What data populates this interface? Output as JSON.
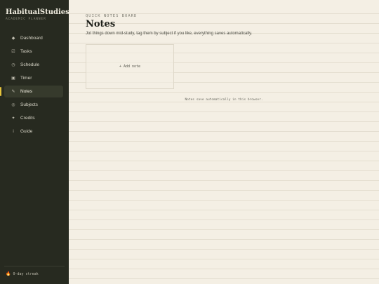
{
  "sidebar": {
    "brand": "HabitualStudies",
    "brand_dot": ".",
    "brand_subtitle": "ACADEMIC PLANNER",
    "items": [
      {
        "label": "Dashboard",
        "icon": "◆"
      },
      {
        "label": "Tasks",
        "icon": "☑"
      },
      {
        "label": "Schedule",
        "icon": "◷"
      },
      {
        "label": "Timer",
        "icon": "▣"
      },
      {
        "label": "Notes",
        "icon": "✎",
        "active": true
      },
      {
        "label": "Subjects",
        "icon": "◎"
      },
      {
        "label": "Credits",
        "icon": "✦"
      },
      {
        "label": "Guide",
        "icon": "i"
      }
    ],
    "streak_icon": "🔥",
    "streak": "0-day streak"
  },
  "main": {
    "eyebrow": "QUICK NOTES BOARD",
    "title": "Notes",
    "subtitle": "Jot things down mid-study, tag them by subject if you like, everything saves automatically.",
    "add_note": "+ Add note",
    "footer": "Notes save automatically in this browser."
  },
  "colors": {
    "sidebar_bg": "#272a20",
    "accent": "#e5c33c",
    "page_bg": "#f4efe4"
  }
}
